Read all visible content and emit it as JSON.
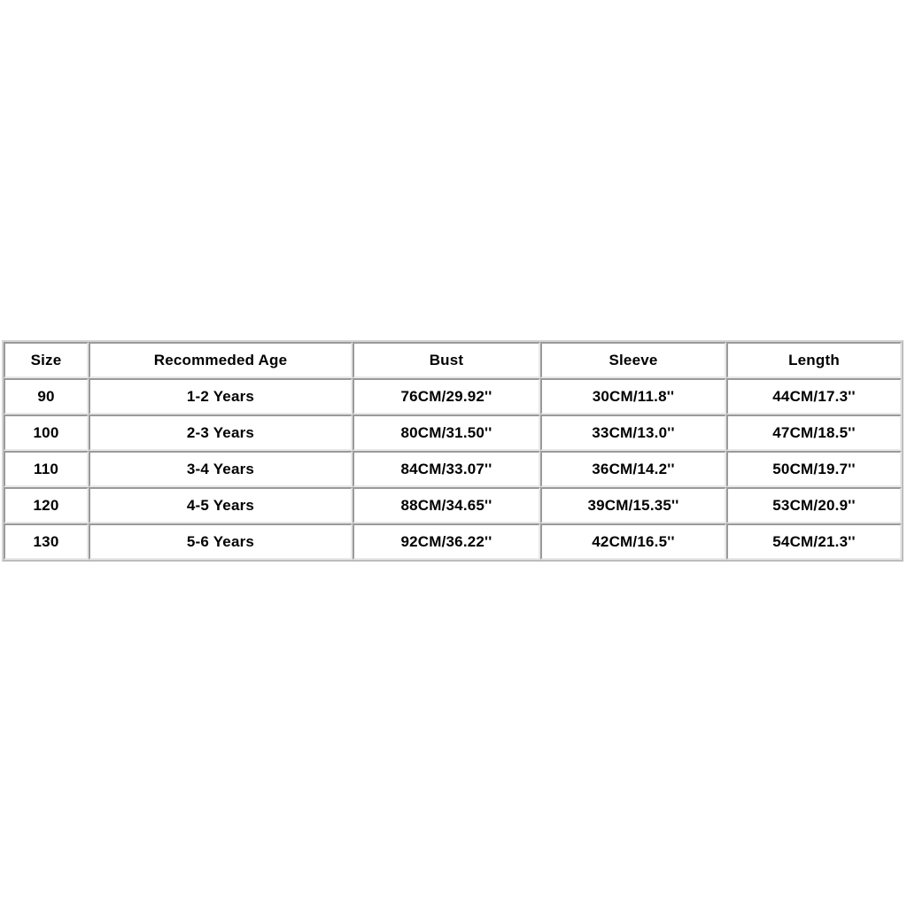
{
  "table": {
    "caption": "",
    "columns": [
      "Size",
      "Recommeded Age",
      "Bust",
      "Sleeve",
      "Length"
    ],
    "rows": [
      {
        "size": "90",
        "age": "1-2 Years",
        "bust": "76CM/29.92''",
        "sleeve": "30CM/11.8''",
        "length": "44CM/17.3''"
      },
      {
        "size": "100",
        "age": "2-3 Years",
        "bust": "80CM/31.50''",
        "sleeve": "33CM/13.0''",
        "length": "47CM/18.5''"
      },
      {
        "size": "110",
        "age": "3-4 Years",
        "bust": "84CM/33.07''",
        "sleeve": "36CM/14.2''",
        "length": "50CM/19.7''"
      },
      {
        "size": "120",
        "age": "4-5 Years",
        "bust": "88CM/34.65''",
        "sleeve": "39CM/15.35''",
        "length": "53CM/20.9''"
      },
      {
        "size": "130",
        "age": "5-6 Years",
        "bust": "92CM/36.22''",
        "sleeve": "42CM/16.5''",
        "length": "54CM/21.3''"
      }
    ]
  },
  "colors": {
    "background": "#ffffff",
    "text": "#000000",
    "cell_border_dark": "#9a9a9a",
    "cell_border_light": "#e8e8e8",
    "table_frame": "#d4d4d4"
  }
}
